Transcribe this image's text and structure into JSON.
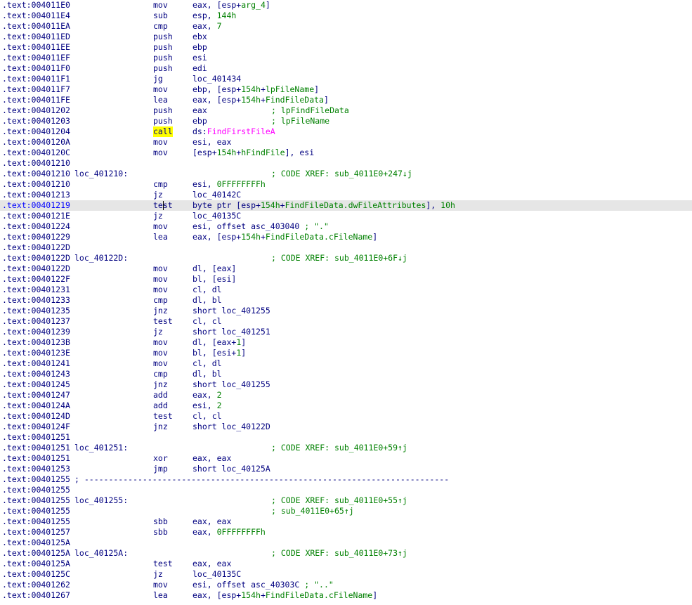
{
  "disassembly": {
    "lines": [
      {
        "addr": ".text:004011E0",
        "mn": "mov",
        "op": [
          {
            "t": "eax, [esp+"
          },
          {
            "t": "arg_4",
            "c": "num"
          },
          {
            "t": "]"
          }
        ]
      },
      {
        "addr": ".text:004011E4",
        "mn": "sub",
        "op": [
          {
            "t": "esp, "
          },
          {
            "t": "144h",
            "c": "num"
          }
        ]
      },
      {
        "addr": ".text:004011EA",
        "mn": "cmp",
        "op": [
          {
            "t": "eax, "
          },
          {
            "t": "7",
            "c": "num"
          }
        ]
      },
      {
        "addr": ".text:004011ED",
        "mn": "push",
        "op": [
          {
            "t": "ebx"
          }
        ]
      },
      {
        "addr": ".text:004011EE",
        "mn": "push",
        "op": [
          {
            "t": "ebp"
          }
        ]
      },
      {
        "addr": ".text:004011EF",
        "mn": "push",
        "op": [
          {
            "t": "esi"
          }
        ]
      },
      {
        "addr": ".text:004011F0",
        "mn": "push",
        "op": [
          {
            "t": "edi"
          }
        ]
      },
      {
        "addr": ".text:004011F1",
        "mn": "jg",
        "op": [
          {
            "t": "loc_401434"
          }
        ]
      },
      {
        "addr": ".text:004011F7",
        "mn": "mov",
        "op": [
          {
            "t": "ebp, [esp+"
          },
          {
            "t": "154h",
            "c": "num"
          },
          {
            "t": "+"
          },
          {
            "t": "lpFileName",
            "c": "num"
          },
          {
            "t": "]"
          }
        ]
      },
      {
        "addr": ".text:004011FE",
        "mn": "lea",
        "op": [
          {
            "t": "eax, [esp+"
          },
          {
            "t": "154h",
            "c": "num"
          },
          {
            "t": "+"
          },
          {
            "t": "FindFileData",
            "c": "num"
          },
          {
            "t": "]"
          }
        ]
      },
      {
        "addr": ".text:00401202",
        "mn": "push",
        "op": [
          {
            "t": "eax"
          }
        ],
        "comment": "; lpFindFileData"
      },
      {
        "addr": ".text:00401203",
        "mn": "push",
        "op": [
          {
            "t": "ebp"
          }
        ],
        "comment": "; lpFileName"
      },
      {
        "addr": ".text:00401204",
        "mn": "call",
        "mnHighlight": true,
        "op": [
          {
            "t": "ds:"
          },
          {
            "t": "FindFirstFileA",
            "c": "imp"
          }
        ]
      },
      {
        "addr": ".text:0040120A",
        "mn": "mov",
        "op": [
          {
            "t": "esi, eax"
          }
        ]
      },
      {
        "addr": ".text:0040120C",
        "mn": "mov",
        "op": [
          {
            "t": "[esp+"
          },
          {
            "t": "154h",
            "c": "num"
          },
          {
            "t": "+"
          },
          {
            "t": "hFindFile",
            "c": "num"
          },
          {
            "t": "], esi"
          }
        ]
      },
      {
        "addr": ".text:00401210"
      },
      {
        "addr": ".text:00401210",
        "label": "loc_401210:",
        "comment": "; CODE XREF: sub_4011E0+247↓j"
      },
      {
        "addr": ".text:00401210",
        "mn": "cmp",
        "op": [
          {
            "t": "esi, "
          },
          {
            "t": "0FFFFFFFFh",
            "c": "num"
          }
        ]
      },
      {
        "addr": ".text:00401213",
        "mn": "jz",
        "op": [
          {
            "t": "loc_40142C"
          }
        ]
      },
      {
        "addr": ".text:00401219",
        "mn": "test",
        "current": true,
        "caret": true,
        "op": [
          {
            "t": "byte ptr [esp+"
          },
          {
            "t": "154h",
            "c": "num"
          },
          {
            "t": "+"
          },
          {
            "t": "FindFileData.dwFileAttributes",
            "c": "num"
          },
          {
            "t": "], "
          },
          {
            "t": "10h",
            "c": "num"
          }
        ]
      },
      {
        "addr": ".text:0040121E",
        "mn": "jz",
        "op": [
          {
            "t": "loc_40135C"
          }
        ]
      },
      {
        "addr": ".text:00401224",
        "mn": "mov",
        "op": [
          {
            "t": "esi, offset asc_403040 "
          },
          {
            "t": "; \".\"",
            "c": "cmtInline"
          }
        ]
      },
      {
        "addr": ".text:00401229",
        "mn": "lea",
        "op": [
          {
            "t": "eax, [esp+"
          },
          {
            "t": "154h",
            "c": "num"
          },
          {
            "t": "+"
          },
          {
            "t": "FindFileData.cFileName",
            "c": "num"
          },
          {
            "t": "]"
          }
        ]
      },
      {
        "addr": ".text:0040122D"
      },
      {
        "addr": ".text:0040122D",
        "label": "loc_40122D:",
        "comment": "; CODE XREF: sub_4011E0+6F↓j"
      },
      {
        "addr": ".text:0040122D",
        "mn": "mov",
        "op": [
          {
            "t": "dl, [eax]"
          }
        ]
      },
      {
        "addr": ".text:0040122F",
        "mn": "mov",
        "op": [
          {
            "t": "bl, [esi]"
          }
        ]
      },
      {
        "addr": ".text:00401231",
        "mn": "mov",
        "op": [
          {
            "t": "cl, dl"
          }
        ]
      },
      {
        "addr": ".text:00401233",
        "mn": "cmp",
        "op": [
          {
            "t": "dl, bl"
          }
        ]
      },
      {
        "addr": ".text:00401235",
        "mn": "jnz",
        "op": [
          {
            "t": "short loc_401255"
          }
        ]
      },
      {
        "addr": ".text:00401237",
        "mn": "test",
        "op": [
          {
            "t": "cl, cl"
          }
        ]
      },
      {
        "addr": ".text:00401239",
        "mn": "jz",
        "op": [
          {
            "t": "short loc_401251"
          }
        ]
      },
      {
        "addr": ".text:0040123B",
        "mn": "mov",
        "op": [
          {
            "t": "dl, [eax+"
          },
          {
            "t": "1",
            "c": "num"
          },
          {
            "t": "]"
          }
        ]
      },
      {
        "addr": ".text:0040123E",
        "mn": "mov",
        "op": [
          {
            "t": "bl, [esi+"
          },
          {
            "t": "1",
            "c": "num"
          },
          {
            "t": "]"
          }
        ]
      },
      {
        "addr": ".text:00401241",
        "mn": "mov",
        "op": [
          {
            "t": "cl, dl"
          }
        ]
      },
      {
        "addr": ".text:00401243",
        "mn": "cmp",
        "op": [
          {
            "t": "dl, bl"
          }
        ]
      },
      {
        "addr": ".text:00401245",
        "mn": "jnz",
        "op": [
          {
            "t": "short loc_401255"
          }
        ]
      },
      {
        "addr": ".text:00401247",
        "mn": "add",
        "op": [
          {
            "t": "eax, "
          },
          {
            "t": "2",
            "c": "num"
          }
        ]
      },
      {
        "addr": ".text:0040124A",
        "mn": "add",
        "op": [
          {
            "t": "esi, "
          },
          {
            "t": "2",
            "c": "num"
          }
        ]
      },
      {
        "addr": ".text:0040124D",
        "mn": "test",
        "op": [
          {
            "t": "cl, cl"
          }
        ]
      },
      {
        "addr": ".text:0040124F",
        "mn": "jnz",
        "op": [
          {
            "t": "short loc_40122D"
          }
        ]
      },
      {
        "addr": ".text:00401251"
      },
      {
        "addr": ".text:00401251",
        "label": "loc_401251:",
        "comment": "; CODE XREF: sub_4011E0+59↑j"
      },
      {
        "addr": ".text:00401251",
        "mn": "xor",
        "op": [
          {
            "t": "eax, eax"
          }
        ]
      },
      {
        "addr": ".text:00401253",
        "mn": "jmp",
        "op": [
          {
            "t": "short loc_40125A"
          }
        ]
      },
      {
        "addr": ".text:00401255",
        "separator": "; ---------------------------------------------------------------------------"
      },
      {
        "addr": ".text:00401255"
      },
      {
        "addr": ".text:00401255",
        "label": "loc_401255:",
        "comment": "; CODE XREF: sub_4011E0+55↑j"
      },
      {
        "addr": ".text:00401255",
        "comment": "; sub_4011E0+65↑j"
      },
      {
        "addr": ".text:00401255",
        "mn": "sbb",
        "op": [
          {
            "t": "eax, eax"
          }
        ]
      },
      {
        "addr": ".text:00401257",
        "mn": "sbb",
        "op": [
          {
            "t": "eax, "
          },
          {
            "t": "0FFFFFFFFh",
            "c": "num"
          }
        ]
      },
      {
        "addr": ".text:0040125A"
      },
      {
        "addr": ".text:0040125A",
        "label": "loc_40125A:",
        "comment": "; CODE XREF: sub_4011E0+73↑j"
      },
      {
        "addr": ".text:0040125A",
        "mn": "test",
        "op": [
          {
            "t": "eax, eax"
          }
        ]
      },
      {
        "addr": ".text:0040125C",
        "mn": "jz",
        "op": [
          {
            "t": "loc_40135C"
          }
        ]
      },
      {
        "addr": ".text:00401262",
        "mn": "mov",
        "op": [
          {
            "t": "esi, offset asc_40303C "
          },
          {
            "t": "; \"..\"",
            "c": "cmtInline"
          }
        ]
      },
      {
        "addr": ".text:00401267",
        "mn": "lea",
        "op": [
          {
            "t": "eax, [esp+"
          },
          {
            "t": "154h",
            "c": "num"
          },
          {
            "t": "+"
          },
          {
            "t": "FindFileData.cFileName",
            "c": "num"
          },
          {
            "t": "]"
          }
        ]
      }
    ]
  },
  "colors": {
    "text": "#000080",
    "comment": "#008000",
    "import": "#ff00ff",
    "highlight": "#ffff00",
    "currentLine": "#e6e6e6",
    "currentAddress": "#0000ff"
  }
}
